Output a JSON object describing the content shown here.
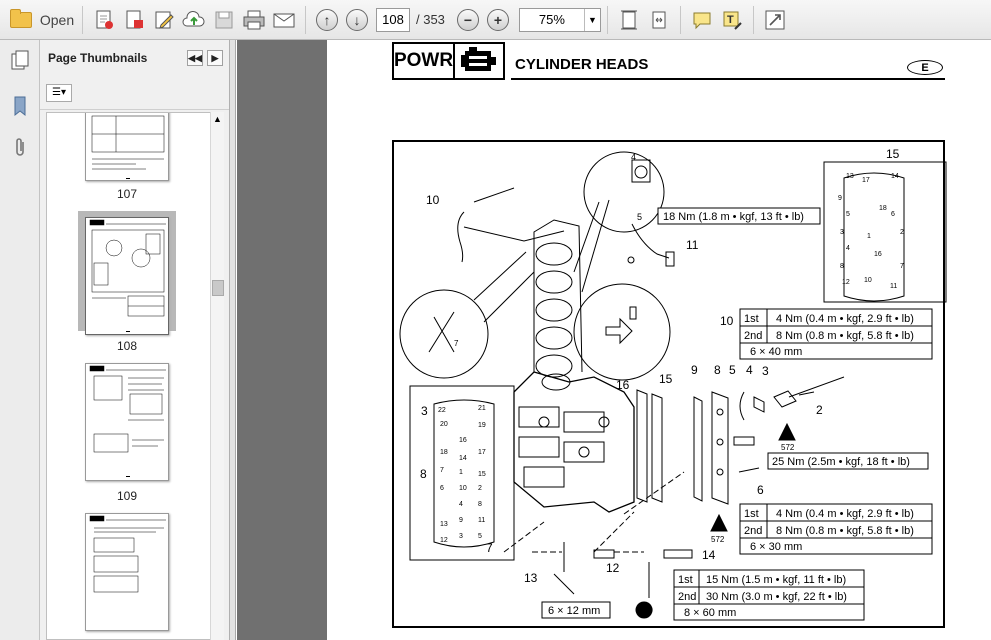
{
  "toolbar": {
    "open_label": "Open",
    "current_page": "108",
    "page_total": "/ 353",
    "zoom_value": "75%"
  },
  "thumbnails": {
    "title": "Page Thumbnails",
    "items": [
      {
        "label": "107"
      },
      {
        "label": "108"
      },
      {
        "label": "109"
      },
      {
        "label": ""
      }
    ]
  },
  "page": {
    "section_code": "POWR",
    "title": "CYLINDER HEADS",
    "lang": "E"
  },
  "diagram": {
    "callouts": [
      "2",
      "3",
      "4",
      "5",
      "6",
      "7",
      "8",
      "9",
      "10",
      "11",
      "12",
      "13",
      "14",
      "15",
      "16",
      "4",
      "5",
      "10",
      "3",
      "8",
      "15",
      "7"
    ],
    "torque_top": "18 Nm (1.8 m • kgf, 13 ft • lb)",
    "table_a": [
      {
        "step": "1st",
        "value": "4 Nm (0.4 m • kgf, 2.9 ft • lb)"
      },
      {
        "step": "2nd",
        "value": "8 Nm (0.8 m • kgf, 5.8 ft • lb)"
      },
      {
        "step": "",
        "value": "6 × 40 mm"
      }
    ],
    "torque_mid": "25 Nm (2.5m • kgf, 18 ft • lb)",
    "table_b": [
      {
        "step": "1st",
        "value": "4 Nm (0.4 m • kgf, 2.9 ft • lb)"
      },
      {
        "step": "2nd",
        "value": "8 Nm (0.8 m • kgf, 5.8 ft • lb)"
      },
      {
        "step": "",
        "value": "6 × 30 mm"
      }
    ],
    "table_c": [
      {
        "step": "1st",
        "value": "15 Nm (1.5 m • kgf, 11 ft • lb)"
      },
      {
        "step": "2nd",
        "value": "30 Nm (3.0 m • kgf, 22 ft • lb)"
      },
      {
        "step": "",
        "value": "8 × 60 mm"
      }
    ],
    "size_small": "6 × 12 mm",
    "lt_code": "572",
    "lt_code2": "572",
    "seq_right": [
      "13",
      "14",
      "9",
      "17",
      "18",
      "5",
      "6",
      "3",
      "2",
      "4",
      "1",
      "16",
      "8",
      "7",
      "12",
      "11",
      "10"
    ],
    "seq_left": [
      "22",
      "21",
      "20",
      "19",
      "18",
      "17",
      "16",
      "15",
      "14",
      "13",
      "12",
      "11",
      "10",
      "9",
      "8",
      "7",
      "6",
      "5",
      "4",
      "3",
      "2",
      "1"
    ]
  },
  "colors": {
    "toolbar_bg": "#ececec",
    "doc_gray": "#707070",
    "selected_thumb": "#b8b8b8"
  }
}
